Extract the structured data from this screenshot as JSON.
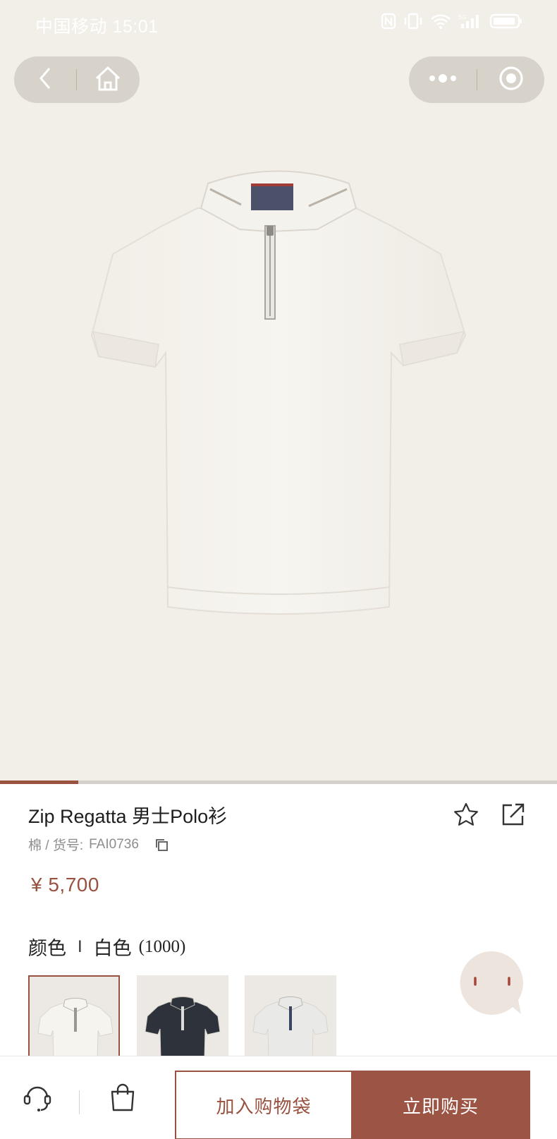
{
  "status_bar": {
    "carrier_time": "中国移动 15:01",
    "icons": [
      "nfc-icon",
      "vibrate-icon",
      "wifi-icon",
      "signal-icon",
      "battery-icon"
    ]
  },
  "nav": {
    "left_capsule": [
      "back-icon",
      "home-icon"
    ],
    "right_capsule": [
      "more-icon",
      "close-miniapp-icon"
    ]
  },
  "gallery": {
    "image": "white zip polo shirt",
    "progress": 0.14
  },
  "product": {
    "title": "Zip Regatta 男士Polo衫",
    "meta_label": "棉 / 货号:",
    "sku": "FAI0736",
    "price": "¥ 5,700",
    "actions": [
      "favorite-star-icon",
      "share-icon"
    ]
  },
  "color": {
    "label": "颜色",
    "separator": "I",
    "selected_name": "白色",
    "selected_code": "(1000)",
    "swatches": [
      {
        "name": "white",
        "selected": true,
        "shirt": "#f6f4ef",
        "placket": "#9a9690"
      },
      {
        "name": "navy",
        "selected": false,
        "shirt": "#2d323b",
        "placket": "#dcdcdc"
      },
      {
        "name": "light-grey",
        "selected": false,
        "shirt": "#e9e9e8",
        "placket": "#3a4660"
      }
    ]
  },
  "bottom_bar": {
    "service_icon": "customer-service-icon",
    "bag_icon": "shopping-bag-icon",
    "add_to_bag": "加入购物袋",
    "buy_now": "立即购买"
  },
  "colors": {
    "accent": "#9a5240",
    "hero_bg": "#f2efe8",
    "capsule_bg": "#d7d2ca"
  }
}
